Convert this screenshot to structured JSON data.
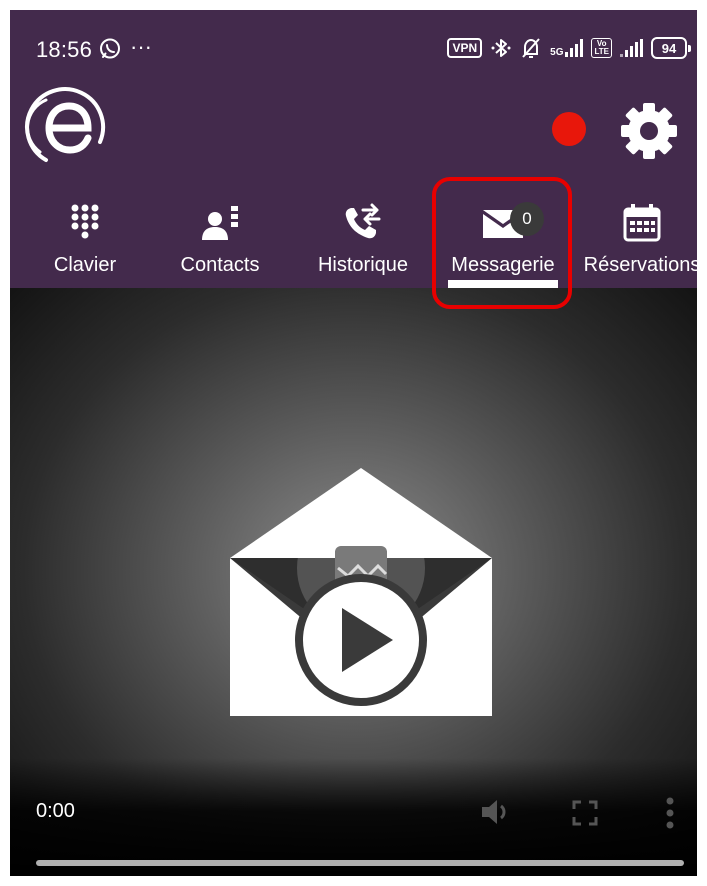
{
  "status_bar": {
    "time": "18:56",
    "more_indicator": "···",
    "vpn_label": "VPN",
    "network_label": "5G",
    "volte_label": "Vo\nLTE",
    "battery_level": "94",
    "icons": [
      "whatsapp-icon",
      "more-icon",
      "vpn-icon",
      "bluetooth-icon",
      "mute-icon",
      "signal-5g-icon",
      "volte-icon",
      "signal-icon",
      "battery-icon"
    ]
  },
  "header": {
    "logo": "e-logo",
    "recording_indicator_color": "#e8170b",
    "settings_icon": "gear-icon",
    "background_color": "#432a4c"
  },
  "tabs": [
    {
      "label": "Clavier",
      "icon": "dialpad-icon",
      "selected": false
    },
    {
      "label": "Contacts",
      "icon": "contacts-icon",
      "selected": false
    },
    {
      "label": "Historique",
      "icon": "call-history-icon",
      "selected": false
    },
    {
      "label": "Messagerie",
      "icon": "voicemail-icon",
      "selected": true,
      "badge": "0"
    },
    {
      "label": "Réservations",
      "icon": "calendar-icon",
      "selected": false
    }
  ],
  "highlight_color": "#e80000",
  "video_player": {
    "poster_icon": "envelope-play-icon",
    "elapsed": "0:00",
    "progress": 0,
    "icons": [
      "volume-icon",
      "fullscreen-icon",
      "kebab-menu-icon"
    ]
  }
}
